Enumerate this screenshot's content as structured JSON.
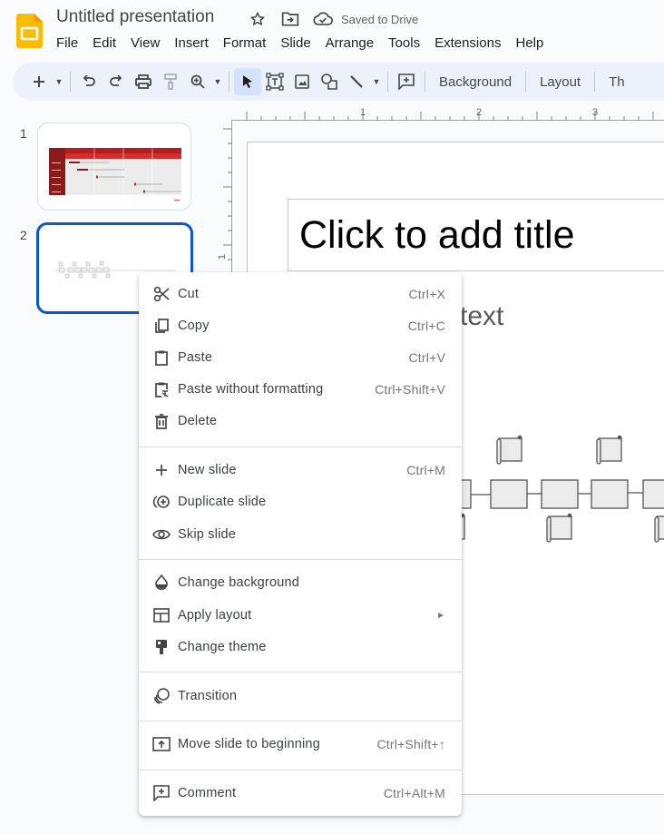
{
  "header": {
    "title": "Untitled presentation",
    "star_icon": "star-icon",
    "move_icon": "move-to-folder-icon",
    "saved_status": "Saved to Drive",
    "logo_color": "#fbbc04"
  },
  "menubar": {
    "items": [
      "File",
      "Edit",
      "View",
      "Insert",
      "Format",
      "Slide",
      "Arrange",
      "Tools",
      "Extensions",
      "Help"
    ]
  },
  "toolbar": {
    "background_label": "Background",
    "layout_label": "Layout",
    "theme_label": "Th",
    "icons": [
      "new-slide-icon",
      "undo-icon",
      "redo-icon",
      "print-icon",
      "paint-format-icon",
      "zoom-icon",
      "select-icon",
      "text-box-icon",
      "image-icon",
      "shape-icon",
      "line-icon",
      "comment-icon"
    ]
  },
  "filmstrip": {
    "slides": [
      {
        "number": "1",
        "content": "gantt-chart-thumbnail",
        "selected": false
      },
      {
        "number": "2",
        "content": "timeline-thumbnail",
        "selected": true
      }
    ],
    "accent": "#0b57d0"
  },
  "ruler": {
    "top_labels": [
      "1",
      "2",
      "3"
    ],
    "left_labels": [
      "1"
    ]
  },
  "slide": {
    "title_placeholder": "Click to add title",
    "subtitle_placeholder_visible": "text"
  },
  "context_menu": {
    "groups": [
      [
        {
          "label": "Cut",
          "shortcut": "Ctrl+X",
          "icon": "cut-icon"
        },
        {
          "label": "Copy",
          "shortcut": "Ctrl+C",
          "icon": "copy-icon"
        },
        {
          "label": "Paste",
          "shortcut": "Ctrl+V",
          "icon": "paste-icon"
        },
        {
          "label": "Paste without formatting",
          "shortcut": "Ctrl+Shift+V",
          "icon": "paste-plain-icon"
        },
        {
          "label": "Delete",
          "shortcut": "",
          "icon": "delete-icon"
        }
      ],
      [
        {
          "label": "New slide",
          "shortcut": "Ctrl+M",
          "icon": "plus-icon"
        },
        {
          "label": "Duplicate slide",
          "shortcut": "",
          "icon": "duplicate-icon"
        },
        {
          "label": "Skip slide",
          "shortcut": "",
          "icon": "eye-icon"
        }
      ],
      [
        {
          "label": "Change background",
          "shortcut": "",
          "icon": "background-icon"
        },
        {
          "label": "Apply layout",
          "shortcut": "",
          "icon": "layout-icon",
          "submenu": "►"
        },
        {
          "label": "Change theme",
          "shortcut": "",
          "icon": "theme-icon"
        }
      ],
      [
        {
          "label": "Transition",
          "shortcut": "",
          "icon": "transition-icon"
        }
      ],
      [
        {
          "label": "Move slide to beginning",
          "shortcut": "Ctrl+Shift+↑",
          "icon": "move-to-beginning-icon"
        }
      ],
      [
        {
          "label": "Comment",
          "shortcut": "Ctrl+Alt+M",
          "icon": "comment-icon"
        }
      ]
    ]
  }
}
